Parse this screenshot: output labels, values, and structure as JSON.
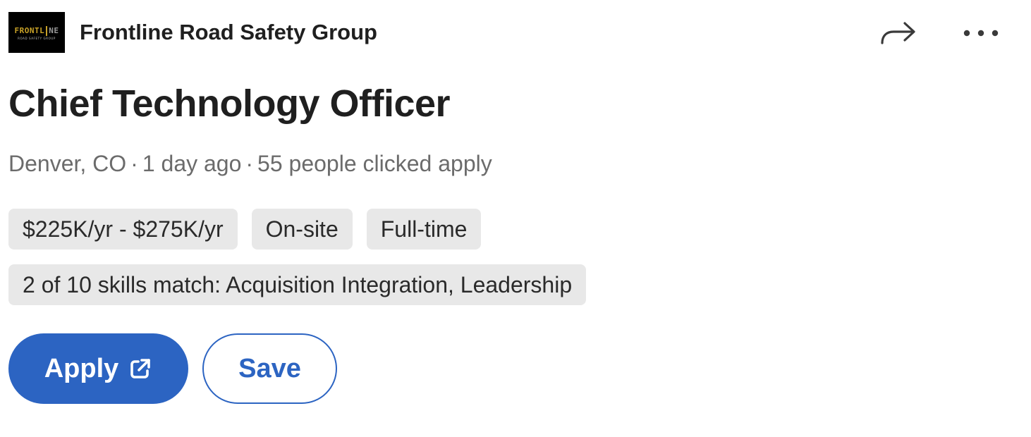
{
  "company": {
    "logo": {
      "main_left": "FRONTL",
      "main_right": "NE",
      "sub": "ROAD SAFETY GROUP"
    },
    "name": "Frontline Road Safety Group"
  },
  "header_actions": {
    "share_icon": "share-arrow-icon",
    "more_icon": "more-horizontal-icon"
  },
  "job": {
    "title": "Chief Technology Officer",
    "location": "Denver, CO",
    "posted": "1 day ago",
    "applicants": "55 people clicked apply",
    "separator": "·"
  },
  "tags": {
    "salary": "$225K/yr - $275K/yr",
    "workplace": "On-site",
    "type": "Full-time",
    "skills": "2 of 10 skills match: Acquisition Integration, Leadership"
  },
  "actions": {
    "apply_label": "Apply",
    "apply_icon": "external-link-icon",
    "save_label": "Save"
  },
  "colors": {
    "accent": "#2c64c2",
    "pill_bg": "#e8e8e8",
    "meta_text": "#6b6b6b",
    "logo_gold": "#c9a227"
  }
}
